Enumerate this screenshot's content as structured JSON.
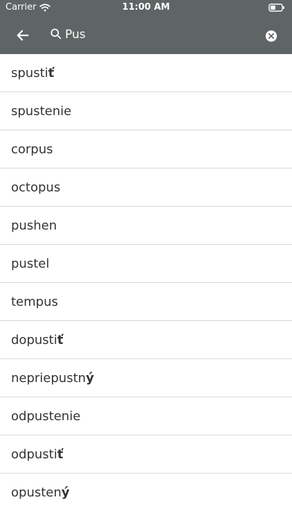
{
  "status_bar": {
    "carrier": "Carrier",
    "time": "11:00 AM"
  },
  "search": {
    "value": "Pus",
    "placeholder": ""
  },
  "icons": {
    "back": "arrow-left-icon",
    "search": "search-icon",
    "clear": "close-circle-icon",
    "wifi": "wifi-icon",
    "battery": "battery-icon"
  },
  "colors": {
    "header_background": "#5f6565",
    "header_foreground": "#ffffff",
    "list_text": "#333333",
    "divider": "#d7d7d7"
  },
  "results": [
    {
      "main": "spusti",
      "accent": "ť"
    },
    {
      "main": "spustenie",
      "accent": ""
    },
    {
      "main": "corpus",
      "accent": ""
    },
    {
      "main": "octopus",
      "accent": ""
    },
    {
      "main": "pushen",
      "accent": ""
    },
    {
      "main": "pustel",
      "accent": ""
    },
    {
      "main": "tempus",
      "accent": ""
    },
    {
      "main": "dopusti",
      "accent": "ť"
    },
    {
      "main": "nepriepustn",
      "accent": "ý"
    },
    {
      "main": "odpustenie",
      "accent": ""
    },
    {
      "main": "odpusti",
      "accent": "ť"
    },
    {
      "main": "opusten",
      "accent": "ý"
    }
  ]
}
